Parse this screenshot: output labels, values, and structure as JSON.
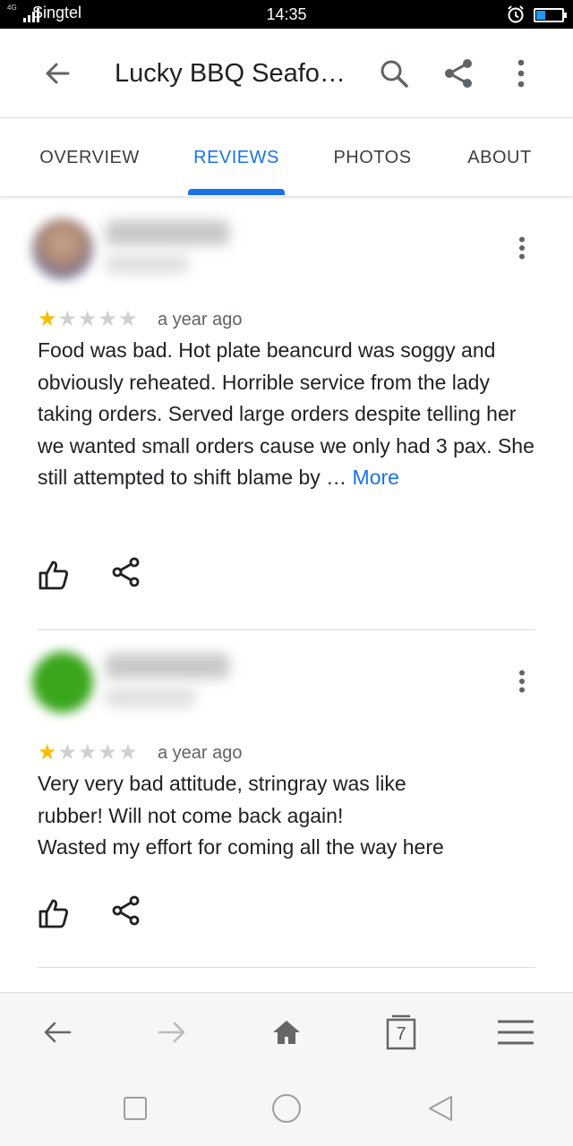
{
  "status_bar": {
    "network": "4G",
    "carrier": "Singtel",
    "time": "14:35",
    "battery_level": 0.35,
    "icons": [
      "signal-icon",
      "alarm-icon",
      "battery-icon"
    ]
  },
  "app_bar": {
    "title": "Lucky BBQ Seafo…",
    "icons": [
      "back-arrow-icon",
      "search-icon",
      "share-icon",
      "more-vert-icon"
    ]
  },
  "tabs": [
    {
      "label": "OVERVIEW",
      "active": false
    },
    {
      "label": "REVIEWS",
      "active": true
    },
    {
      "label": "PHOTOS",
      "active": false
    },
    {
      "label": "ABOUT",
      "active": false
    }
  ],
  "reviews": [
    {
      "rating": 1,
      "max_rating": 5,
      "time": "a year ago",
      "text": "Food was bad. Hot plate beancurd was soggy and obviously reheated. Horrible service from the lady taking orders. Served large orders despite telling her we wanted small orders cause we only had 3 pax. She still attempted to shift blame by … ",
      "more_label": "More",
      "avatar_color": "#b89a8a"
    },
    {
      "rating": 1,
      "max_rating": 5,
      "time": "a year ago",
      "text": "Very very bad attitude, stringray was like\nrubber! Will  not come back again!\nWasted my effort for coming all the way here",
      "more_label": "",
      "avatar_color": "#3aa61c"
    }
  ],
  "browser_bar": {
    "tab_count": "7",
    "icons": [
      "back-arrow-icon",
      "forward-arrow-icon",
      "home-icon",
      "tabs-icon",
      "menu-icon"
    ]
  },
  "colors": {
    "accent": "#1a73e8",
    "star": "#fbbc04",
    "star_empty": "#d0d0d0"
  }
}
